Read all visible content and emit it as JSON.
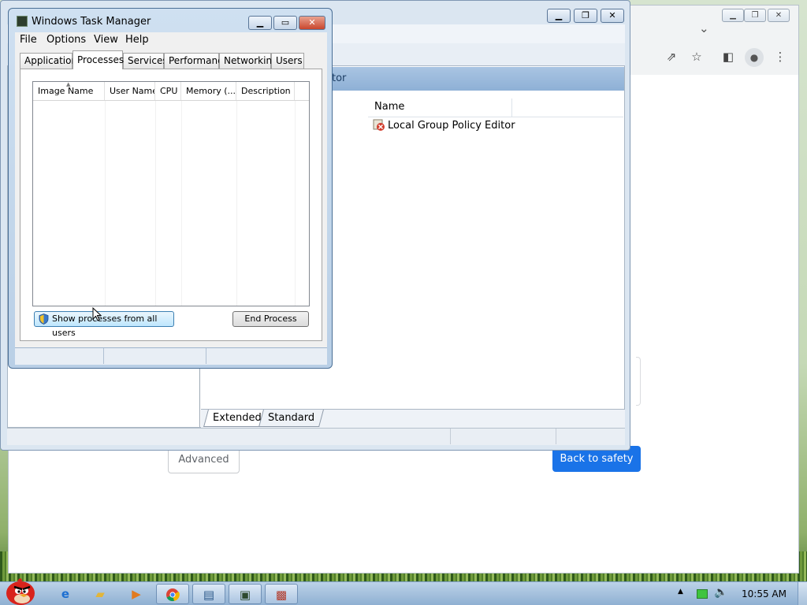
{
  "chrome": {
    "chevron": "⌄",
    "toolbar_icons": [
      "share-icon",
      "star-icon",
      "sidebar-icon",
      "profile-icon",
      "kebab-menu-icon"
    ],
    "advanced_label": "Advanced",
    "back_label": "Back to safety",
    "accent_color": "#1a73e8"
  },
  "gpedit": {
    "header_partial": "tor",
    "column_name": "Name",
    "item_label": "Local Group Policy Editor",
    "tabs": [
      "Extended",
      "Standard"
    ]
  },
  "taskmgr": {
    "title": "Windows Task Manager",
    "menu": [
      "File",
      "Options",
      "View",
      "Help"
    ],
    "tabs": [
      "Applications",
      "Processes",
      "Services",
      "Performance",
      "Networking",
      "Users"
    ],
    "selected_tab": "Processes",
    "columns": [
      "Image Name",
      "User Name",
      "CPU",
      "Memory (...",
      "Description"
    ],
    "show_all_label": "Show processes from all users",
    "end_process_label": "End Process"
  },
  "taskbar": {
    "clock": "10:55 AM"
  }
}
